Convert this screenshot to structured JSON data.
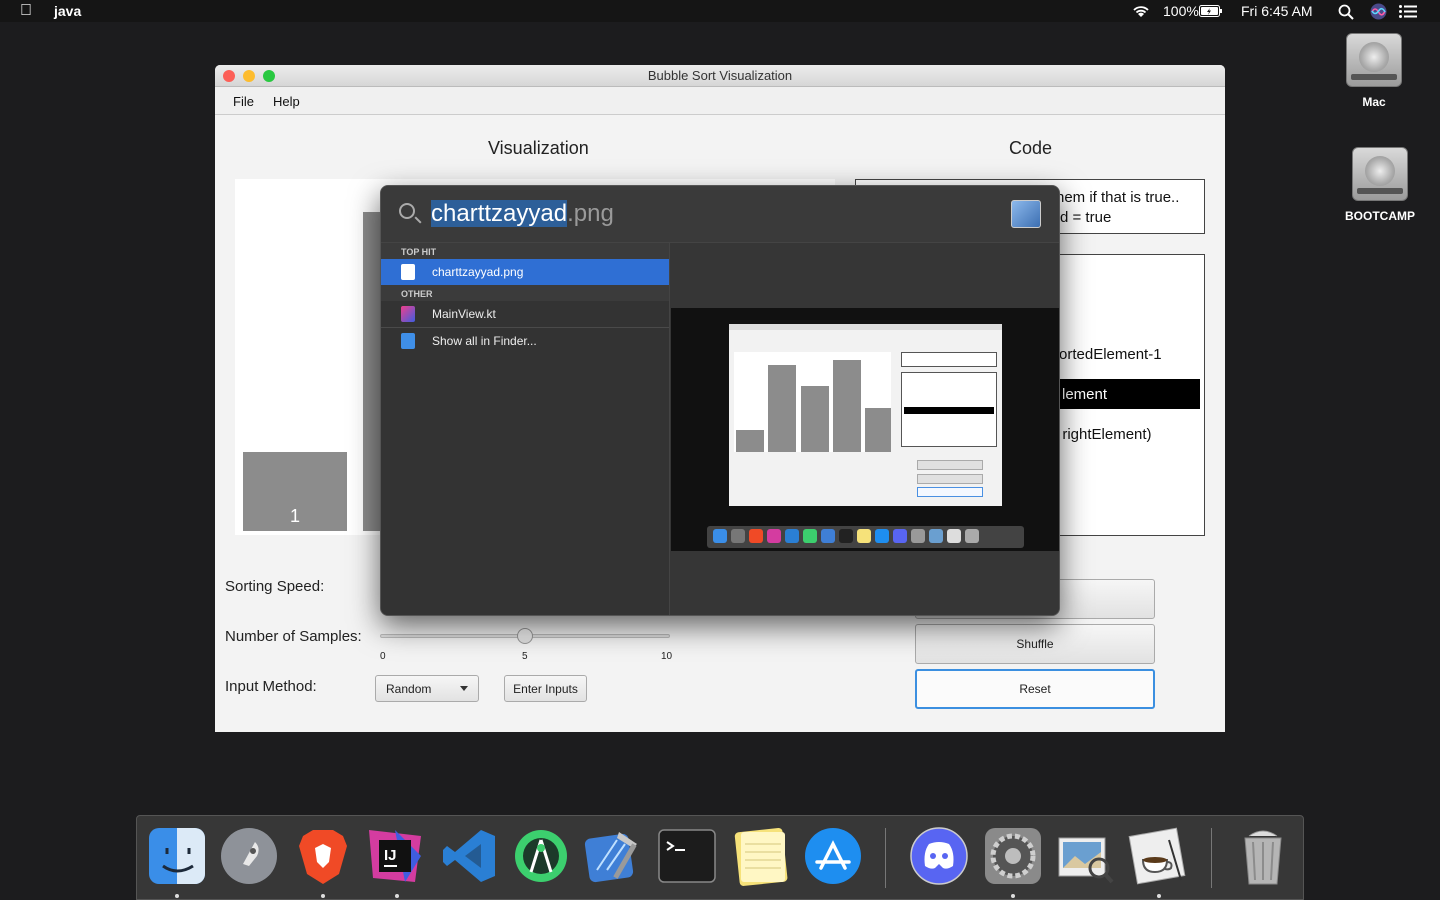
{
  "menubar": {
    "app_name": "java",
    "battery": "100%",
    "clock": "Fri 6:45 AM"
  },
  "desktop": {
    "icons": [
      {
        "label": "Mac"
      },
      {
        "label": "BOOTCAMP"
      }
    ]
  },
  "window": {
    "title": "Bubble Sort Visualization",
    "menus": [
      "File",
      "Help"
    ],
    "viz_title": "Visualization",
    "code_title": "Code",
    "visible_bar_label": "1",
    "code_top": [
      "hem if that is true..",
      "d = true"
    ],
    "code_lines": [
      "ortedElement-1",
      "lement",
      ", rightElement)"
    ],
    "controls": {
      "speed_label": "Sorting Speed:",
      "samples_label": "Number of Samples:",
      "samples_ticks": [
        "0",
        "5",
        "10"
      ],
      "samples_value": 5,
      "input_label": "Input Method:",
      "input_method_selected": "Random",
      "enter_inputs": "Enter Inputs",
      "shuffle": "Shuffle",
      "reset": "Reset"
    }
  },
  "spotlight": {
    "query_selected": "charttzayyad",
    "query_rest": ".png",
    "top_hit_header": "TOP HIT",
    "top_hit": "charttzayyad.png",
    "other_header": "OTHER",
    "other_items": [
      "MainView.kt",
      "Show all in Finder..."
    ]
  },
  "preview": {
    "bars": [
      1,
      4,
      3,
      5,
      2
    ]
  },
  "dock": {
    "apps": [
      "finder-icon",
      "launchpad-icon",
      "brave-icon",
      "intellij-icon",
      "vscode-icon",
      "android-studio-icon",
      "xcode-icon",
      "terminal-icon",
      "notes-icon",
      "app-store-icon",
      "discord-icon",
      "system-preferences-icon",
      "preview-icon",
      "java-icon",
      "trash-icon"
    ]
  }
}
